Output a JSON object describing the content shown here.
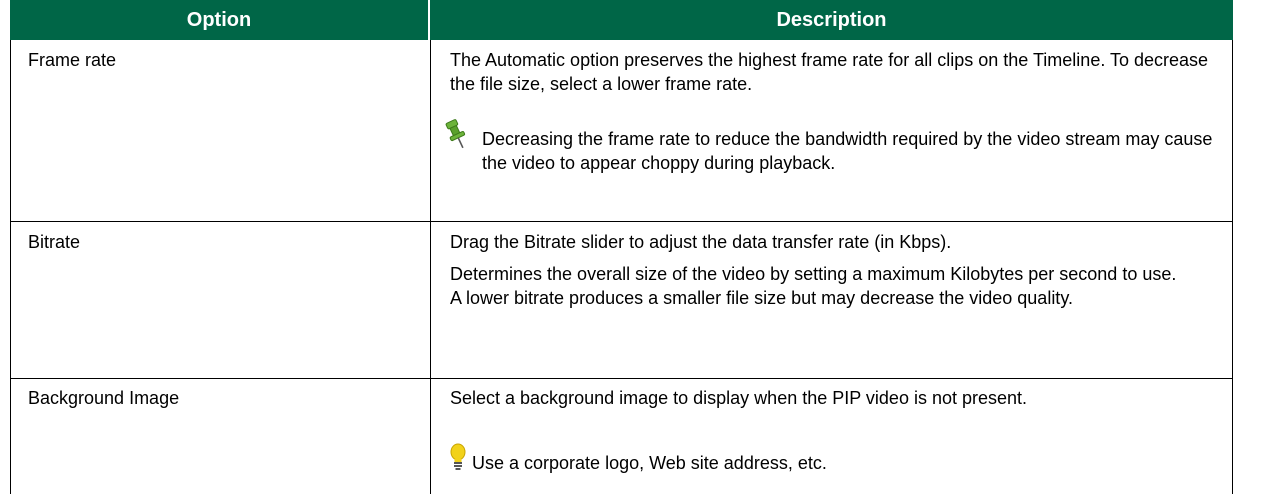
{
  "table": {
    "headers": {
      "option": "Option",
      "description": "Description"
    },
    "rows": [
      {
        "option": "Frame rate",
        "paragraphs": [
          "The Automatic option preserves the highest frame rate for all clips on the Timeline. To decrease the file size, select a lower frame rate."
        ],
        "note": {
          "icon": "pushpin-icon",
          "text": "Decreasing the frame rate to reduce the bandwidth required by the video stream may cause the video to appear choppy during playback."
        }
      },
      {
        "option": "Bitrate",
        "paragraphs": [
          "Drag the Bitrate slider to adjust the data transfer rate (in Kbps).",
          "Determines the overall size of the video by setting a maximum Kilobytes per second to use. A lower bitrate produces a smaller file size but may decrease the video quality."
        ]
      },
      {
        "option": "Background Image",
        "paragraphs": [
          "Select a background image to display when the PIP video is not present."
        ],
        "note": {
          "icon": "lightbulb-icon",
          "text": "Use a corporate logo, Web site address, etc."
        }
      }
    ]
  },
  "colors": {
    "header_bg": "#006647",
    "header_text": "#ffffff",
    "pin": "#5aa02c",
    "bulb": "#f2d21a"
  }
}
